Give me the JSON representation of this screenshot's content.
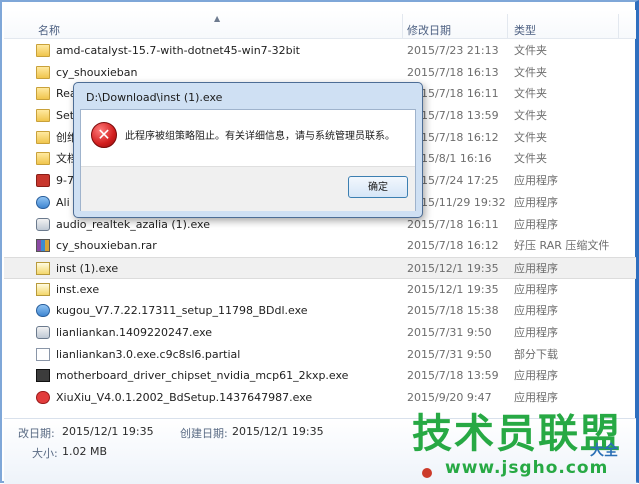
{
  "columns": {
    "name": "名称",
    "date": "修改日期",
    "type": "类型"
  },
  "files": [
    {
      "name": "amd-catalyst-15.7-with-dotnet45-win7-32bit",
      "date": "2015/7/23 21:13",
      "type": "文件夹",
      "icon": "folder"
    },
    {
      "name": "cy_shouxieban",
      "date": "2015/7/18 16:13",
      "type": "文件夹",
      "icon": "folder"
    },
    {
      "name": "Rea",
      "date": "2015/7/18 16:11",
      "type": "文件夹",
      "icon": "folder"
    },
    {
      "name": "Set",
      "date": "2015/7/18 13:59",
      "type": "文件夹",
      "icon": "folder"
    },
    {
      "name": "创维",
      "date": "2015/7/18 16:12",
      "type": "文件夹",
      "icon": "folder"
    },
    {
      "name": "文档",
      "date": "2015/8/1 16:16",
      "type": "文件夹",
      "icon": "folder"
    },
    {
      "name": "9-7",
      "date": "2015/7/24 17:25",
      "type": "应用程序",
      "icon": "red"
    },
    {
      "name": "Ali",
      "date": "2015/11/29 19:32",
      "type": "应用程序",
      "icon": "blue"
    },
    {
      "name": "audio_realtek_azalia (1).exe",
      "date": "2015/7/18 16:11",
      "type": "应用程序",
      "icon": "gear"
    },
    {
      "name": "cy_shouxieban.rar",
      "date": "2015/7/18 16:12",
      "type": "好压 RAR 压缩文件",
      "icon": "rar"
    },
    {
      "name": "inst (1).exe",
      "date": "2015/12/1 19:35",
      "type": "应用程序",
      "icon": "exe",
      "selected": true
    },
    {
      "name": "inst.exe",
      "date": "2015/12/1 19:35",
      "type": "应用程序",
      "icon": "exe"
    },
    {
      "name": "kugou_V7.7.22.17311_setup_11798_BDdl.exe",
      "date": "2015/7/18 15:38",
      "type": "应用程序",
      "icon": "blue"
    },
    {
      "name": "lianliankan.1409220247.exe",
      "date": "2015/7/31 9:50",
      "type": "应用程序",
      "icon": "gear"
    },
    {
      "name": "lianliankan3.0.exe.c9c8sl6.partial",
      "date": "2015/7/31 9:50",
      "type": "部分下载",
      "icon": "partial"
    },
    {
      "name": "motherboard_driver_chipset_nvidia_mcp61_2kxp.exe",
      "date": "2015/7/18 13:59",
      "type": "应用程序",
      "icon": "dark"
    },
    {
      "name": "XiuXiu_V4.0.1.2002_BdSetup.1437647987.exe",
      "date": "2015/9/20 9:47",
      "type": "应用程序",
      "icon": "xiu"
    }
  ],
  "details": {
    "modified_label": "改日期:",
    "modified_value": "2015/12/1 19:35",
    "created_label": "创建日期:",
    "created_value": "2015/12/1 19:35",
    "size_label": "大小:",
    "size_value": "1.02 MB"
  },
  "dialog": {
    "title": "D:\\Download\\inst (1).exe",
    "message": "此程序被组策略阻止。有关详细信息，请与系统管理员联系。",
    "ok_label": "确定",
    "icon": "error-icon"
  },
  "watermark": {
    "brand": "技术员联盟",
    "sub": "大全",
    "url": "www.jsgho.com"
  }
}
